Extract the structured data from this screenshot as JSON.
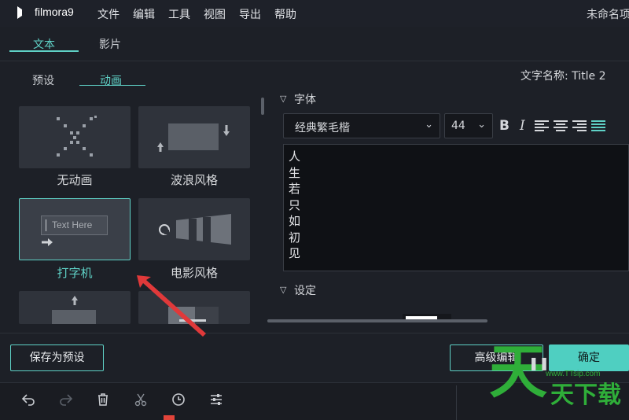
{
  "app": {
    "name": "filmora9",
    "menu": [
      "文件",
      "编辑",
      "工具",
      "视图",
      "导出",
      "帮助"
    ],
    "document_title": "未命名项"
  },
  "main_tabs": [
    "文本",
    "影片"
  ],
  "sub_tabs": [
    "预设",
    "动画"
  ],
  "animations": [
    {
      "label": "无动画",
      "selected": false
    },
    {
      "label": "波浪风格",
      "selected": false
    },
    {
      "label": "打字机",
      "selected": true,
      "preview_text": "Text Here"
    },
    {
      "label": "电影风格",
      "selected": false
    }
  ],
  "text_name": {
    "label": "文字名称:",
    "value": "Title 2"
  },
  "font_section": {
    "title": "字体",
    "font_family": "经典繁毛楷",
    "font_size": "44",
    "bold": "B",
    "italic": "I",
    "text_lines": "人\n生\n若\n只\n如\n初\n见"
  },
  "settings_section": {
    "title": "设定"
  },
  "buttons": {
    "save_preset": "保存为预设",
    "advanced_edit": "高级编辑",
    "confirm": "确定"
  },
  "toolbar_icons": [
    "undo-icon",
    "redo-icon",
    "delete-icon",
    "scissors-icon",
    "clock-icon",
    "sliders-icon"
  ],
  "watermark": {
    "big": "天",
    "small": "天下载",
    "url": "www.TTsip.com"
  },
  "colors": {
    "accent": "#5fd1c6",
    "background": "#1d2027",
    "watermark": "#2fae39",
    "annotation_arrow": "#e0393a"
  }
}
